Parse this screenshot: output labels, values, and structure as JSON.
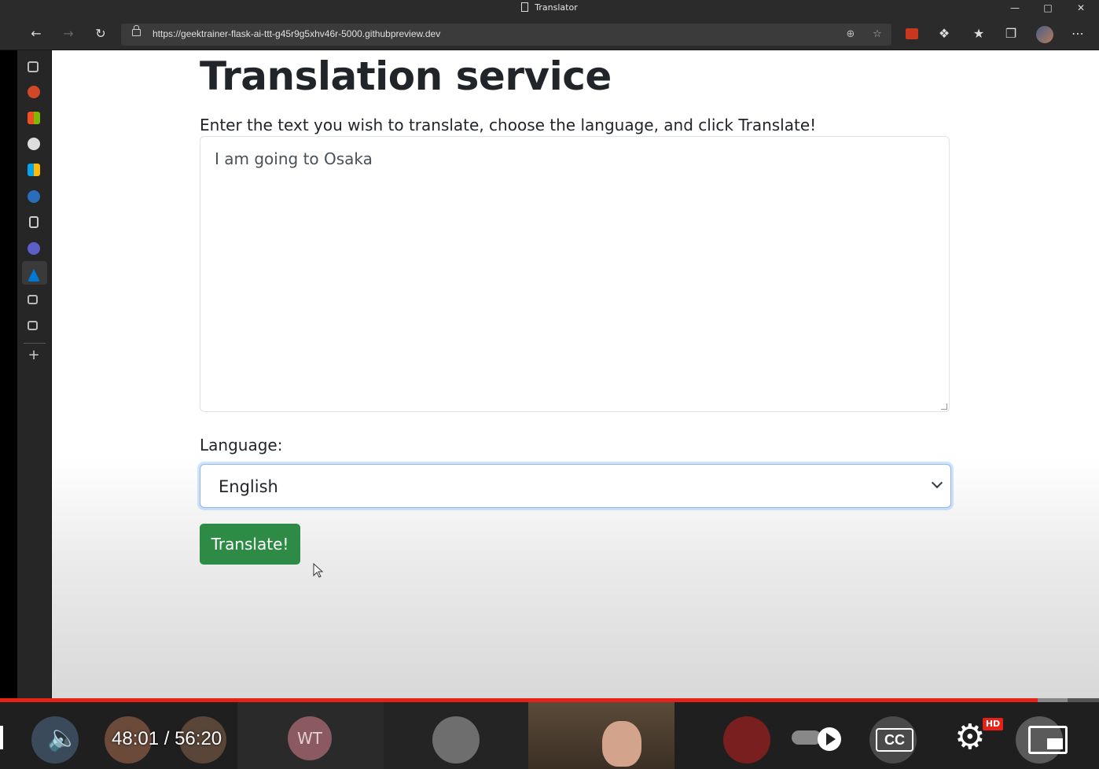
{
  "window": {
    "title": "Translator"
  },
  "browser": {
    "url": "https://geektrainer-flask-ai-ttt-g45r9g5xhv46r-5000.githubpreview.dev"
  },
  "page": {
    "heading": "Translation service",
    "instructions": "Enter the text you wish to translate, choose the language, and click Translate!",
    "text_input_value": "I am going to Osaka",
    "language_label": "Language:",
    "language_selected": "English",
    "submit_label": "Translate!",
    "colors": {
      "button": "#2e8b46",
      "select_focus": "#86b7fe"
    }
  },
  "player": {
    "time_current": "48:01",
    "time_separator": "/",
    "time_total": "56:20",
    "progress_fraction": 0.9441,
    "participant_initials": "WT",
    "hd_badge": "HD",
    "cc_label": "CC",
    "progress_color": "#e62117"
  }
}
